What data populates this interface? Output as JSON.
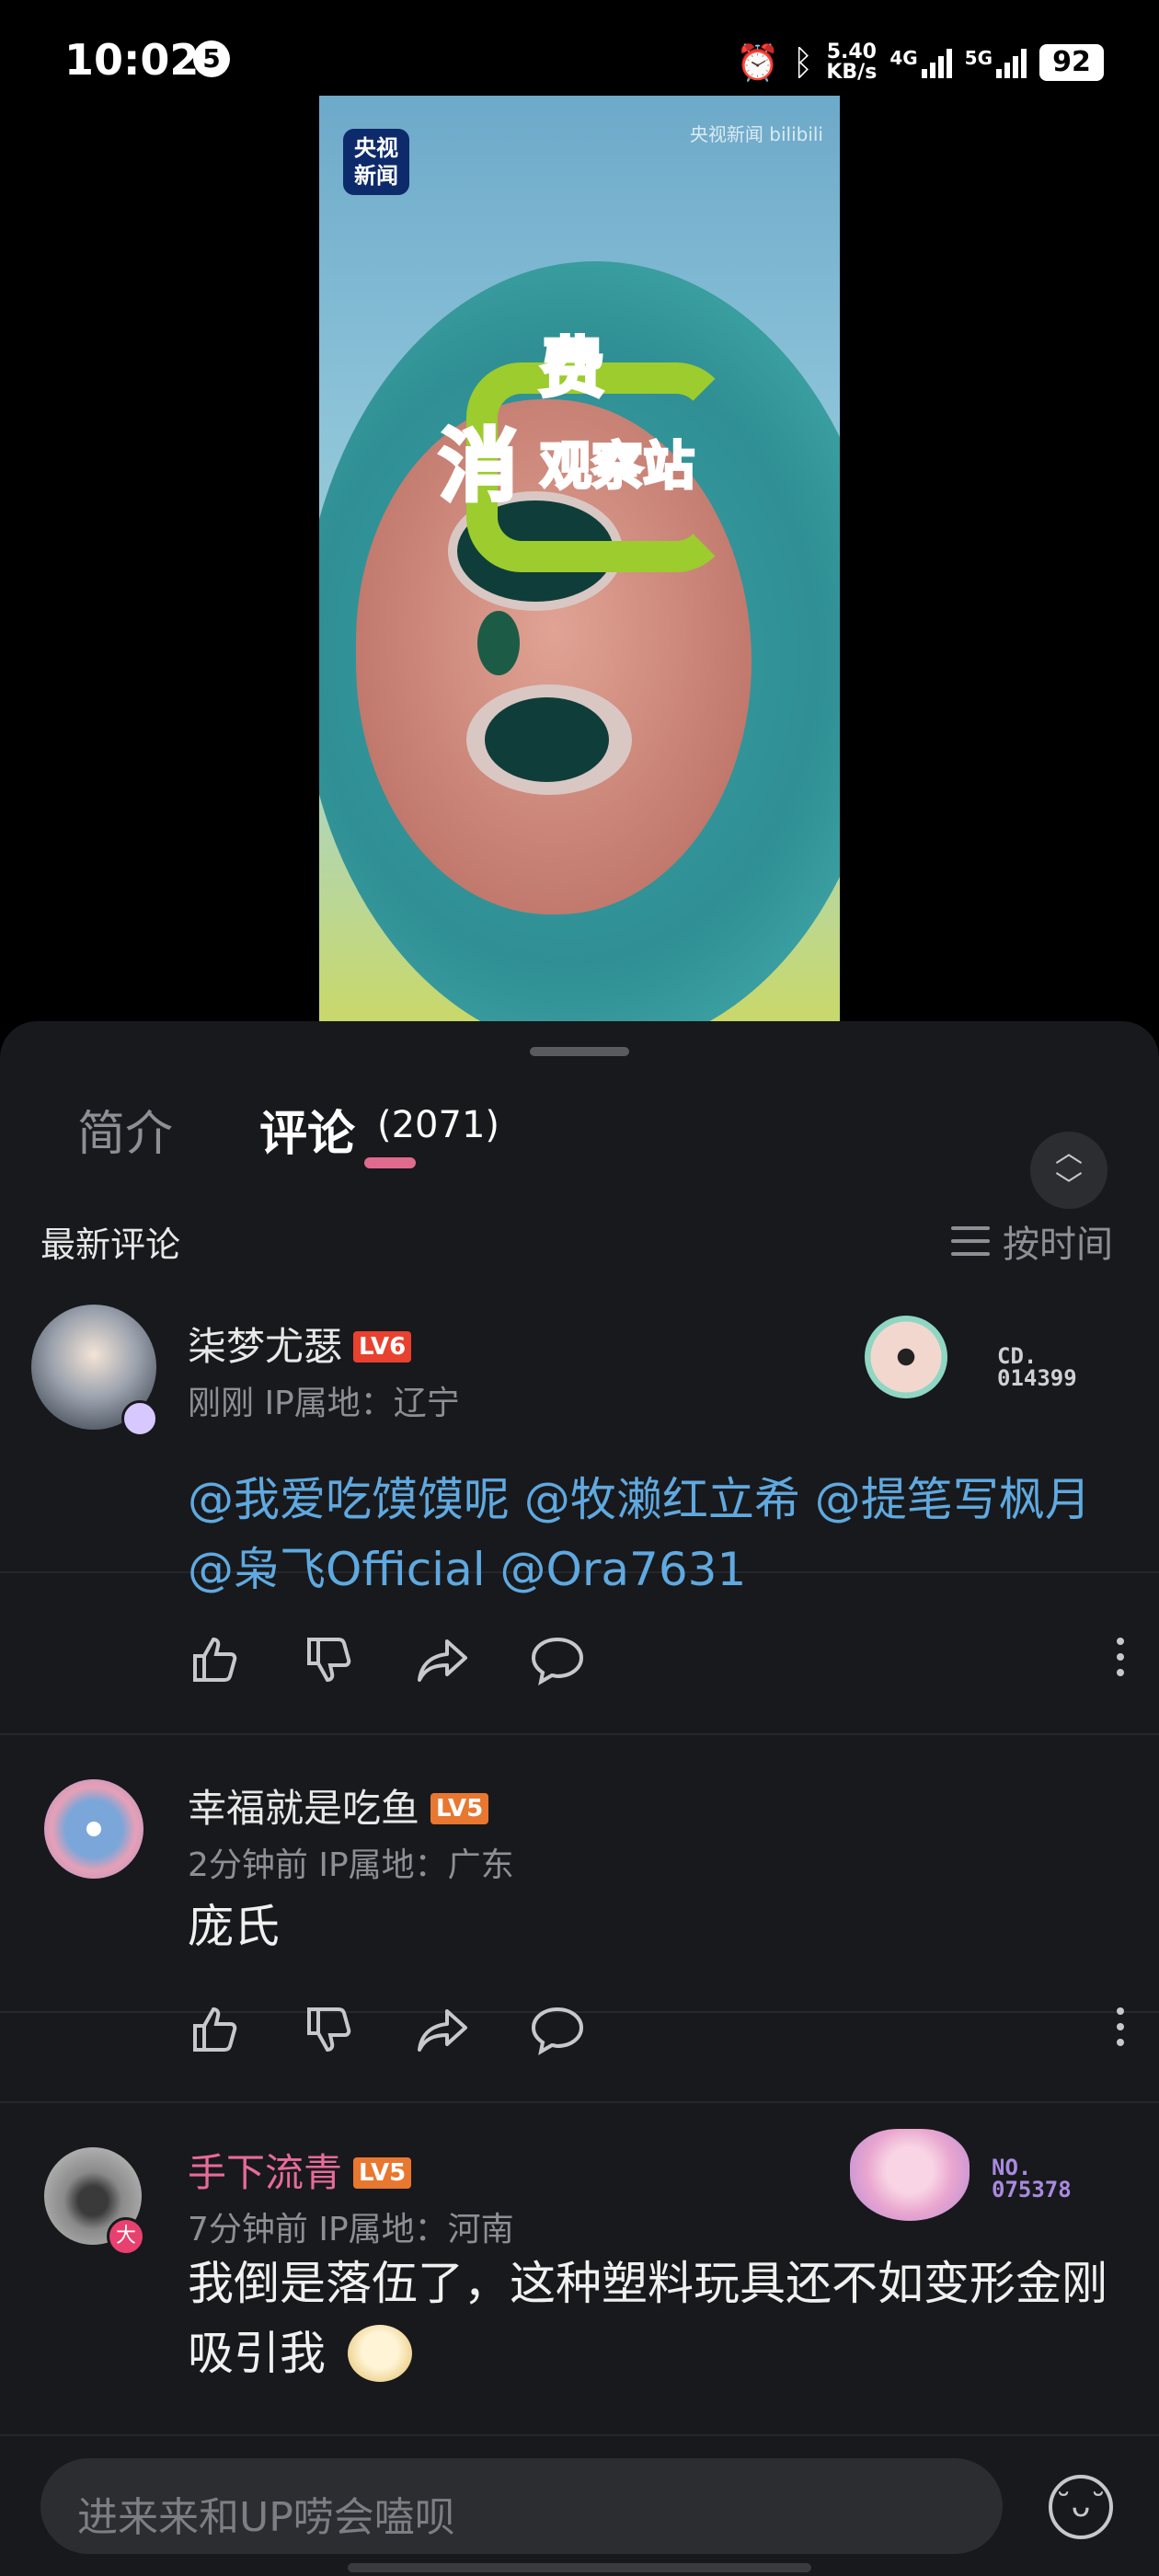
{
  "status_bar": {
    "time": "10:02",
    "notification_count": "5",
    "net_speed_value": "5.40",
    "net_speed_unit": "KB/s",
    "network_1": "4G",
    "network_2": "5G",
    "battery": "92",
    "icons": [
      "alarm-icon",
      "bluetooth-icon",
      "signal-icon"
    ]
  },
  "video": {
    "channel_logo_line1": "央视",
    "channel_logo_line2": "新闻",
    "watermark": "央视新闻 bilibili",
    "brand_top": "费",
    "brand_main": "消",
    "brand_suffix": "观察站"
  },
  "tabs": {
    "intro_label": "简介",
    "comments_label": "评论",
    "comments_count": "(2071)",
    "active": "comments"
  },
  "sort": {
    "section_title": "最新评论",
    "sort_label": "按时间"
  },
  "comments": [
    {
      "username": "柒梦尤瑟",
      "level": "LV6",
      "meta": "刚刚 IP属地：辽宁",
      "body_parts": [
        "@我爱吃馍馍呢 @牧濑红立希 @提笔写枫月 @枭飞Official @Ora7631"
      ],
      "badge_no_line1": "CD.",
      "badge_no_line2": "014399"
    },
    {
      "username": "幸福就是吃鱼",
      "level": "LV5",
      "meta": "2分钟前 IP属地：广东",
      "body": "庞氏"
    },
    {
      "username": "手下流青",
      "level": "LV5",
      "meta": "7分钟前 IP属地：河南",
      "body": "我倒是落伍了，这种塑料玩具还不如变形金刚吸引我",
      "badge_no_line1": "NO.",
      "badge_no_line2": "075378",
      "avatar_badge": "大"
    }
  ],
  "input": {
    "placeholder": "进来来和UP唠会嗑呗"
  },
  "colors": {
    "accent_pink": "#e06a8e",
    "mention_blue": "#5fa9e0",
    "lv6": "#e8412f",
    "lv5": "#e8772f",
    "panel_bg": "#18191c"
  }
}
